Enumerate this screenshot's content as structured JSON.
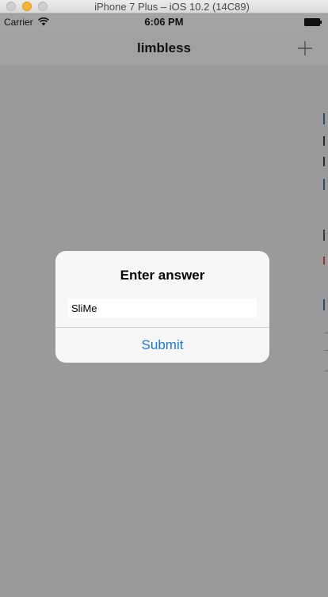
{
  "window": {
    "title": "iPhone 7 Plus – iOS 10.2 (14C89)"
  },
  "status_bar": {
    "carrier": "Carrier",
    "time": "6:06 PM",
    "wifi_icon": "wifi-icon",
    "battery_icon": "battery-icon"
  },
  "nav_bar": {
    "title": "limbless",
    "add_icon": "plus-icon"
  },
  "alert": {
    "title": "Enter answer",
    "input_value": "SliMe",
    "submit_label": "Submit"
  },
  "colors": {
    "accent": "#1a7ad4",
    "overlay": "#9a9a9a",
    "alert_background": "#f7f7f7"
  }
}
